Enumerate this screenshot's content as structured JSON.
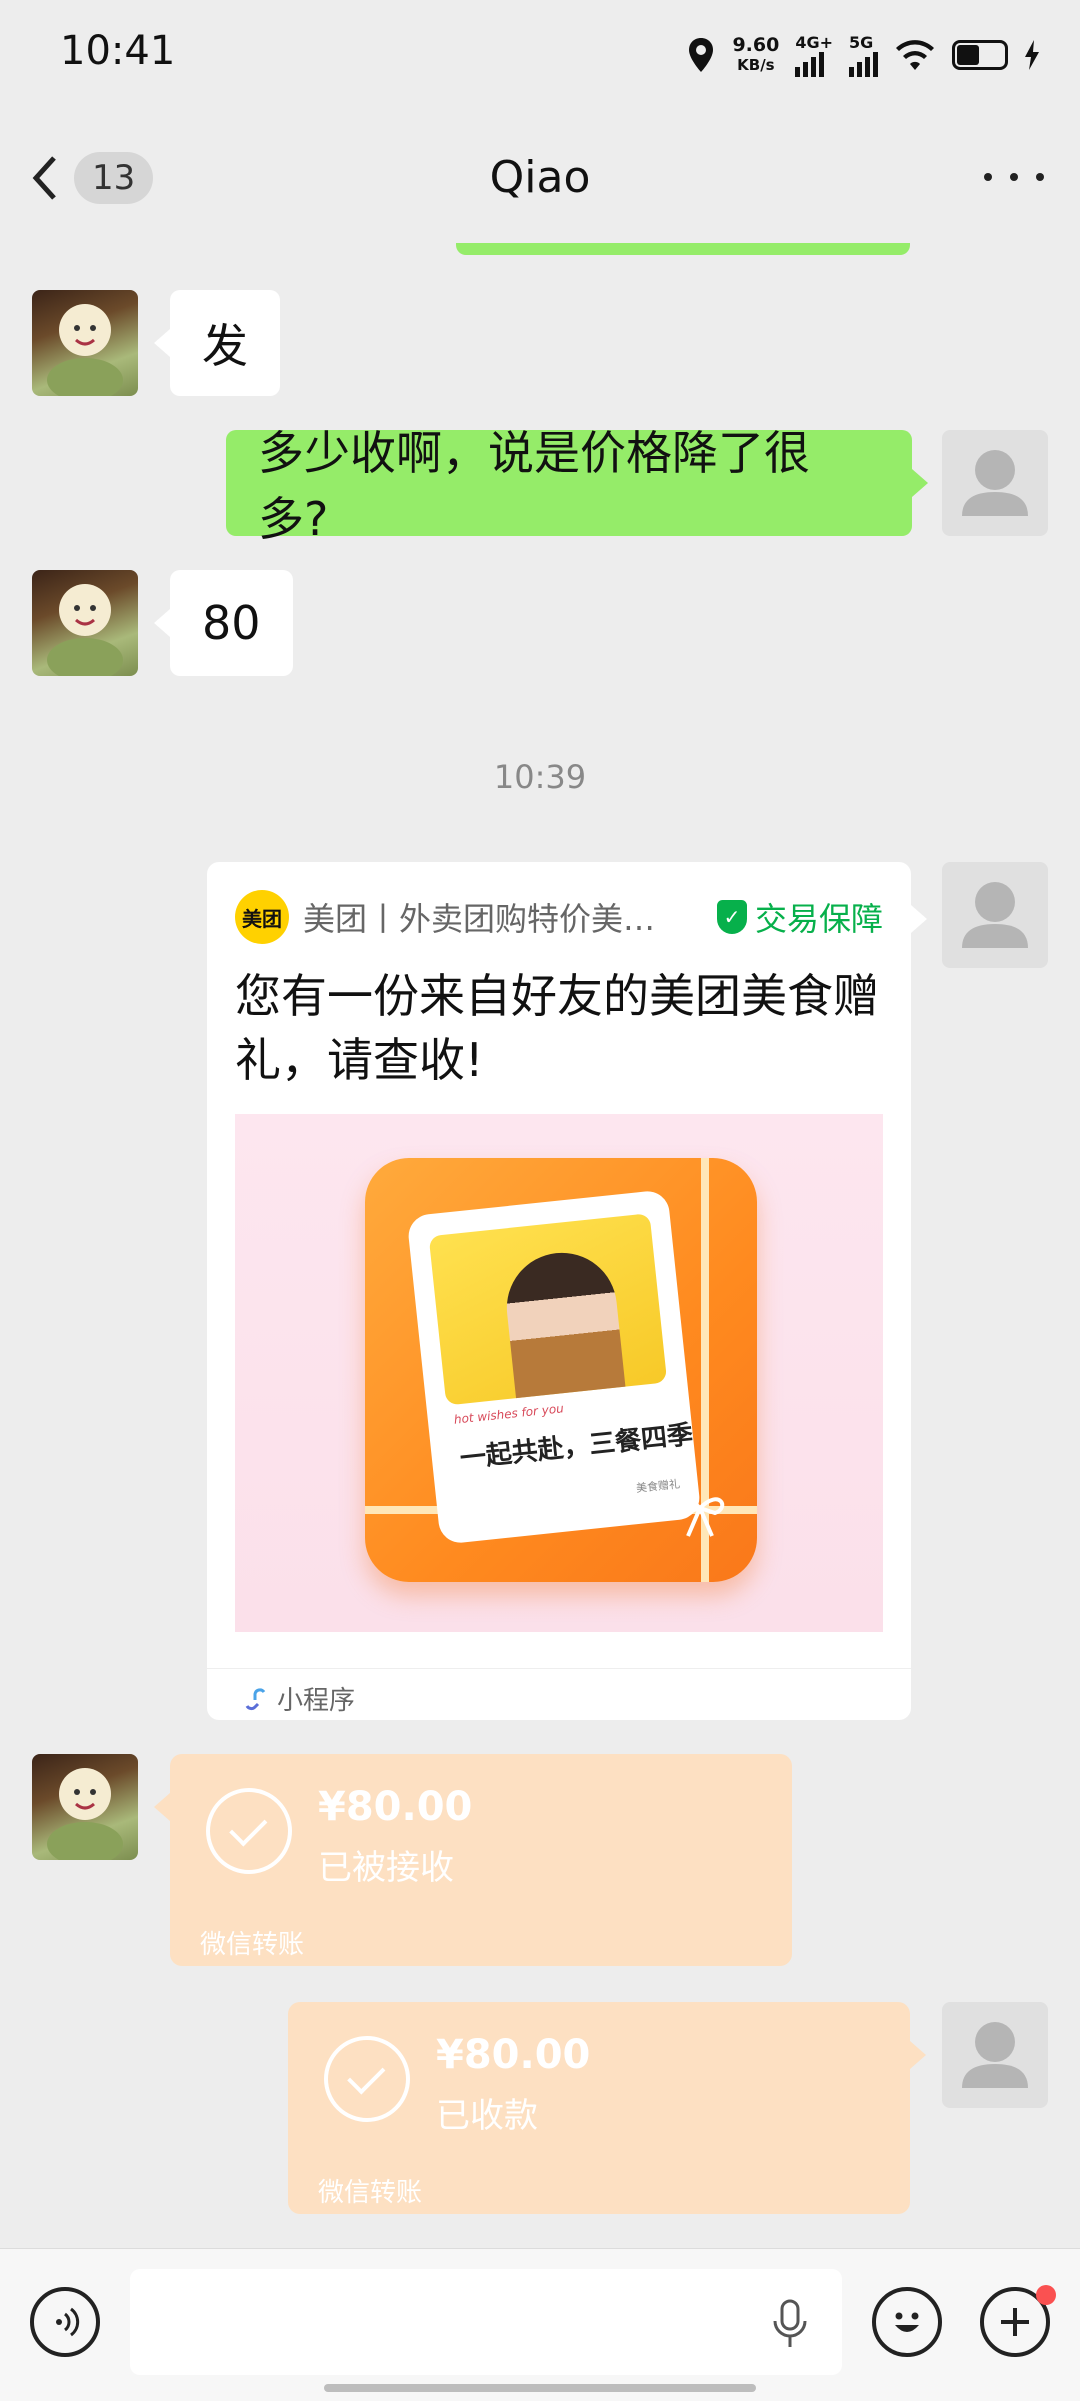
{
  "status_bar": {
    "time": "10:41",
    "net_speed": "9.60",
    "net_unit": "KB/s",
    "sig1": "4G+",
    "sig2": "5G"
  },
  "header": {
    "back_count": "13",
    "title": "Qiao"
  },
  "messages": {
    "m1": "发",
    "m2": "多少收啊，说是价格降了很多?",
    "m3": "80"
  },
  "timestamp": "10:39",
  "mini_program": {
    "logo_text": "美团",
    "source": "美团丨外卖团购特价美食…",
    "guarantee": "交易保障",
    "title": "您有一份来自好友的美团美食赠礼，请查收!",
    "image_slogan": "一起共赴，三餐四季",
    "image_small": "hot wishes for you",
    "image_tag": "美食赠礼",
    "footer": "小程序"
  },
  "transfers": [
    {
      "amount": "¥80.00",
      "status": "已被接收",
      "label": "微信转账"
    },
    {
      "amount": "¥80.00",
      "status": "已收款",
      "label": "微信转账"
    }
  ],
  "colors": {
    "green_bubble": "#95ec69",
    "transfer_bg": "#fde0c2",
    "accent_green": "#07b04b"
  },
  "icons": [
    "back-arrow-icon",
    "more-icon",
    "location-icon",
    "wifi-icon",
    "battery-icon",
    "voice-icon",
    "mic-icon",
    "emoji-icon",
    "plus-icon",
    "check-icon",
    "link-icon",
    "shield-icon"
  ]
}
